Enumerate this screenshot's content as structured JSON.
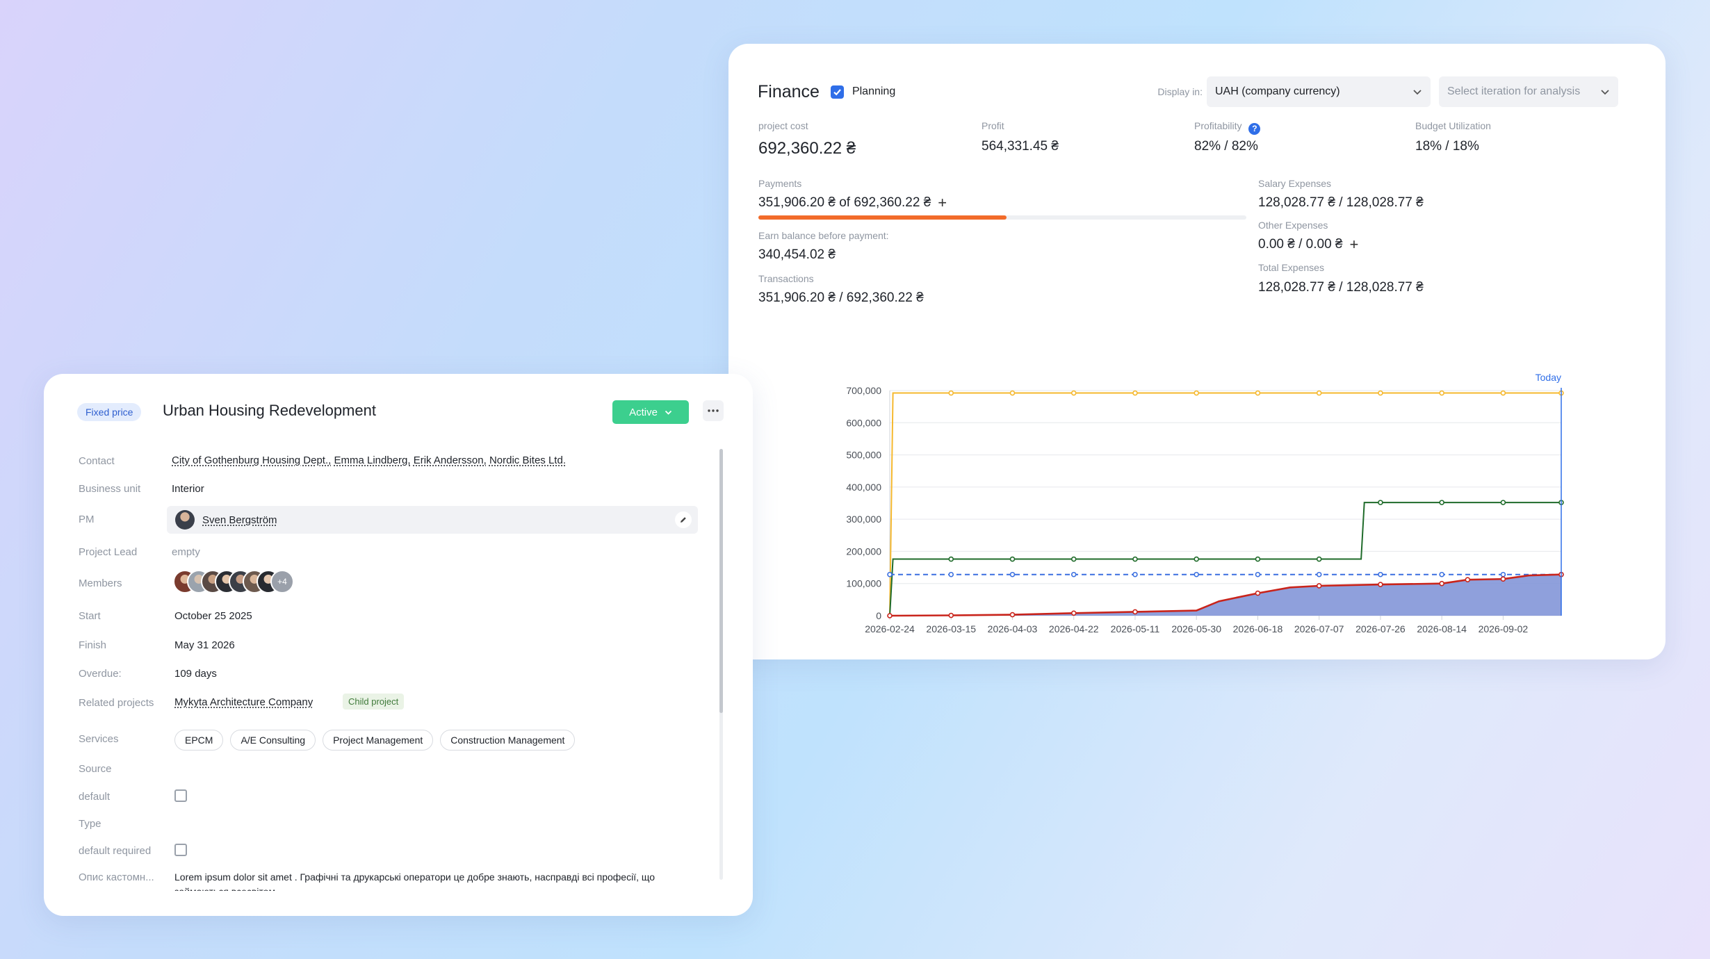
{
  "finance": {
    "title": "Finance",
    "planning_label": "Planning",
    "planning_checked": true,
    "display_in_label": "Display in:",
    "currency_value": "UAH (company currency)",
    "iteration_placeholder": "Select iteration for analysis",
    "metrics": {
      "project_cost": {
        "label": "project cost",
        "value": "692,360.22 ₴"
      },
      "profit": {
        "label": "Profit",
        "value": "564,331.45 ₴"
      },
      "profitability": {
        "label": "Profitability",
        "value": "82% / 82%"
      },
      "budget_utilization": {
        "label": "Budget Utilization",
        "value": "18% / 18%"
      },
      "payments": {
        "label": "Payments",
        "value": "351,906.20 ₴ of 692,360.22 ₴",
        "progress_percent": 50.8
      },
      "earn_balance": {
        "label": "Earn balance before payment:",
        "value": "340,454.02 ₴"
      },
      "transactions": {
        "label": "Transactions",
        "value": "351,906.20 ₴ / 692,360.22 ₴"
      },
      "salary_expenses": {
        "label": "Salary Expenses",
        "value": "128,028.77 ₴ / 128,028.77 ₴"
      },
      "other_expenses": {
        "label": "Other Expenses",
        "value": "0.00 ₴ / 0.00 ₴"
      },
      "total_expenses": {
        "label": "Total Expenses",
        "value": "128,028.77 ₴ / 128,028.77 ₴"
      }
    },
    "colors": {
      "accent": "#2f6ee8",
      "progress": "#f26b2a",
      "budget": "#f5b82e",
      "payments": "#1f6b2a",
      "expenses": "#3a6fe0",
      "actual": "#c9241b",
      "area": "#7b8fd6"
    }
  },
  "chart_data": {
    "type": "line",
    "today_label": "Today",
    "x_ticks": [
      "2026-02-24",
      "2026-03-15",
      "2026-04-03",
      "2026-04-22",
      "2026-05-11",
      "2026-05-30",
      "2026-06-18",
      "2026-07-07",
      "2026-07-26",
      "2026-08-14",
      "2026-09-02"
    ],
    "y_ticks": [
      "0",
      "100,000",
      "200,000",
      "300,000",
      "400,000",
      "500,000",
      "600,000",
      "700,000"
    ],
    "ylim": [
      0,
      700000
    ],
    "xlim": [
      "2026-02-24",
      "2026-09-20"
    ],
    "series": [
      {
        "key": "budget",
        "color": "#f5b82e",
        "dashed": false,
        "x": [
          "2026-02-24",
          "2026-02-25",
          "2026-03-15",
          "2026-04-03",
          "2026-04-22",
          "2026-05-11",
          "2026-05-30",
          "2026-06-18",
          "2026-07-07",
          "2026-07-26",
          "2026-08-14",
          "2026-09-02",
          "2026-09-20"
        ],
        "y": [
          0,
          692360,
          692360,
          692360,
          692360,
          692360,
          692360,
          692360,
          692360,
          692360,
          692360,
          692360,
          692360
        ],
        "markers": [
          false,
          false,
          true,
          true,
          true,
          true,
          true,
          true,
          true,
          true,
          true,
          true,
          true
        ]
      },
      {
        "key": "payments",
        "color": "#1f6b2a",
        "dashed": false,
        "x": [
          "2026-02-24",
          "2026-02-25",
          "2026-03-15",
          "2026-04-03",
          "2026-04-22",
          "2026-05-11",
          "2026-05-30",
          "2026-06-18",
          "2026-07-07",
          "2026-07-20",
          "2026-07-21",
          "2026-07-26",
          "2026-08-14",
          "2026-09-02",
          "2026-09-20"
        ],
        "y": [
          0,
          176000,
          176000,
          176000,
          176000,
          176000,
          176000,
          176000,
          176000,
          176000,
          351906,
          351906,
          351906,
          351906,
          351906
        ],
        "markers": [
          false,
          false,
          true,
          true,
          true,
          true,
          true,
          true,
          true,
          false,
          false,
          true,
          true,
          true,
          true
        ]
      },
      {
        "key": "expenses",
        "color": "#3a6fe0",
        "dashed": true,
        "x": [
          "2026-02-24",
          "2026-03-15",
          "2026-04-03",
          "2026-04-22",
          "2026-05-11",
          "2026-05-30",
          "2026-06-18",
          "2026-07-07",
          "2026-07-26",
          "2026-08-14",
          "2026-09-02",
          "2026-09-20"
        ],
        "y": [
          128029,
          128029,
          128029,
          128029,
          128029,
          128029,
          128029,
          128029,
          128029,
          128029,
          128029,
          128029
        ],
        "markers": [
          true,
          true,
          true,
          true,
          true,
          true,
          true,
          true,
          true,
          true,
          true,
          true
        ]
      },
      {
        "key": "actual",
        "color": "#c9241b",
        "dashed": false,
        "area": true,
        "x": [
          "2026-02-24",
          "2026-03-15",
          "2026-04-03",
          "2026-04-22",
          "2026-05-11",
          "2026-05-30",
          "2026-06-06",
          "2026-06-18",
          "2026-06-28",
          "2026-07-07",
          "2026-07-26",
          "2026-08-14",
          "2026-08-22",
          "2026-09-02",
          "2026-09-10",
          "2026-09-20"
        ],
        "y": [
          0,
          1000,
          3000,
          8000,
          12000,
          16000,
          45000,
          70000,
          88000,
          93000,
          97000,
          100000,
          112000,
          114000,
          125000,
          128029
        ],
        "markers": [
          true,
          true,
          true,
          true,
          true,
          false,
          false,
          true,
          false,
          true,
          true,
          true,
          true,
          true,
          false,
          true
        ]
      }
    ]
  },
  "project": {
    "badge": "Fixed price",
    "title": "Urban Housing Redevelopment",
    "status": "Active",
    "more_icon": "more-dots-icon",
    "fields": {
      "contact": {
        "label": "Contact",
        "values": [
          "City of Gothenburg Housing Dept.,",
          "Emma Lindberg,",
          "Erik Andersson,",
          "Nordic Bites Ltd."
        ]
      },
      "business_unit": {
        "label": "Business unit",
        "value": "Interior"
      },
      "pm": {
        "label": "PM",
        "value": "Sven Bergström"
      },
      "project_lead": {
        "label": "Project Lead",
        "value": "empty"
      },
      "members": {
        "label": "Members",
        "extra": "+4"
      },
      "start": {
        "label": "Start",
        "value": "October 25 2025"
      },
      "finish": {
        "label": "Finish",
        "value": "May 31 2026"
      },
      "overdue": {
        "label": "Overdue:",
        "value": "109 days"
      },
      "related": {
        "label": "Related projects",
        "value": "Mykyta Architecture Company",
        "tag": "Child project"
      },
      "services": {
        "label": "Services",
        "values": [
          "EPCM",
          "A/E Consulting",
          "Project Management",
          "Construction Management"
        ]
      },
      "source": {
        "label": "Source"
      },
      "default": {
        "label": "default"
      },
      "type": {
        "label": "Type"
      },
      "default_required": {
        "label": "default required"
      },
      "description": {
        "label": "Опис кастомн...",
        "value": "Lorem ipsum dolor sit amet . Графічні та друкарські оператори це добре знають, насправді всі професії, що займаються всесвітом"
      }
    }
  }
}
